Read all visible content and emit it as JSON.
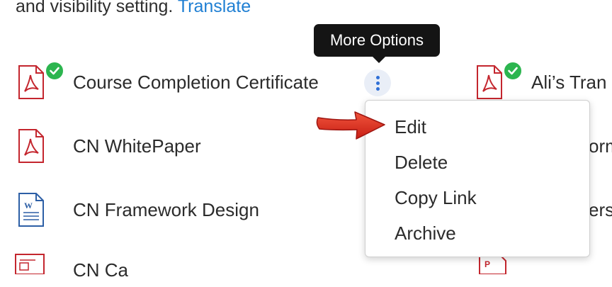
{
  "intro": {
    "text": "and visibility setting. ",
    "link": "Translate"
  },
  "files_left": [
    {
      "name": "Course Completion Certificate",
      "type": "pdf",
      "verified": true
    },
    {
      "name": "CN WhitePaper",
      "type": "pdf",
      "verified": false
    },
    {
      "name": "CN Framework Design",
      "type": "word",
      "verified": false
    },
    {
      "name": "CN Ca",
      "type": "ppt",
      "verified": false
    }
  ],
  "files_right": [
    {
      "name": "Ali’s Tran",
      "type": "pdf",
      "verified": true
    },
    {
      "name": "orm",
      "type": "pdf",
      "verified": false
    },
    {
      "name": "ers",
      "type": "word",
      "verified": false
    },
    {
      "name": "",
      "type": "ppt",
      "verified": false
    }
  ],
  "tooltip": {
    "label": "More Options"
  },
  "menu": {
    "items": [
      "Edit",
      "Delete",
      "Copy Link",
      "Archive"
    ]
  },
  "colors": {
    "link": "#1f7fd3",
    "pdf_icon": "#c4262e",
    "word_icon": "#2d5fa6",
    "check": "#2cb54f",
    "more_button_bg": "#e9eef7",
    "more_button_dots": "#2f6fd6",
    "annotation_arrow": "#d9261c"
  },
  "icons": {
    "pdf": "pdf-file-icon",
    "word": "word-file-icon",
    "ppt": "ppt-file-icon",
    "check": "check-circle-icon",
    "more": "vertical-ellipsis-icon"
  }
}
